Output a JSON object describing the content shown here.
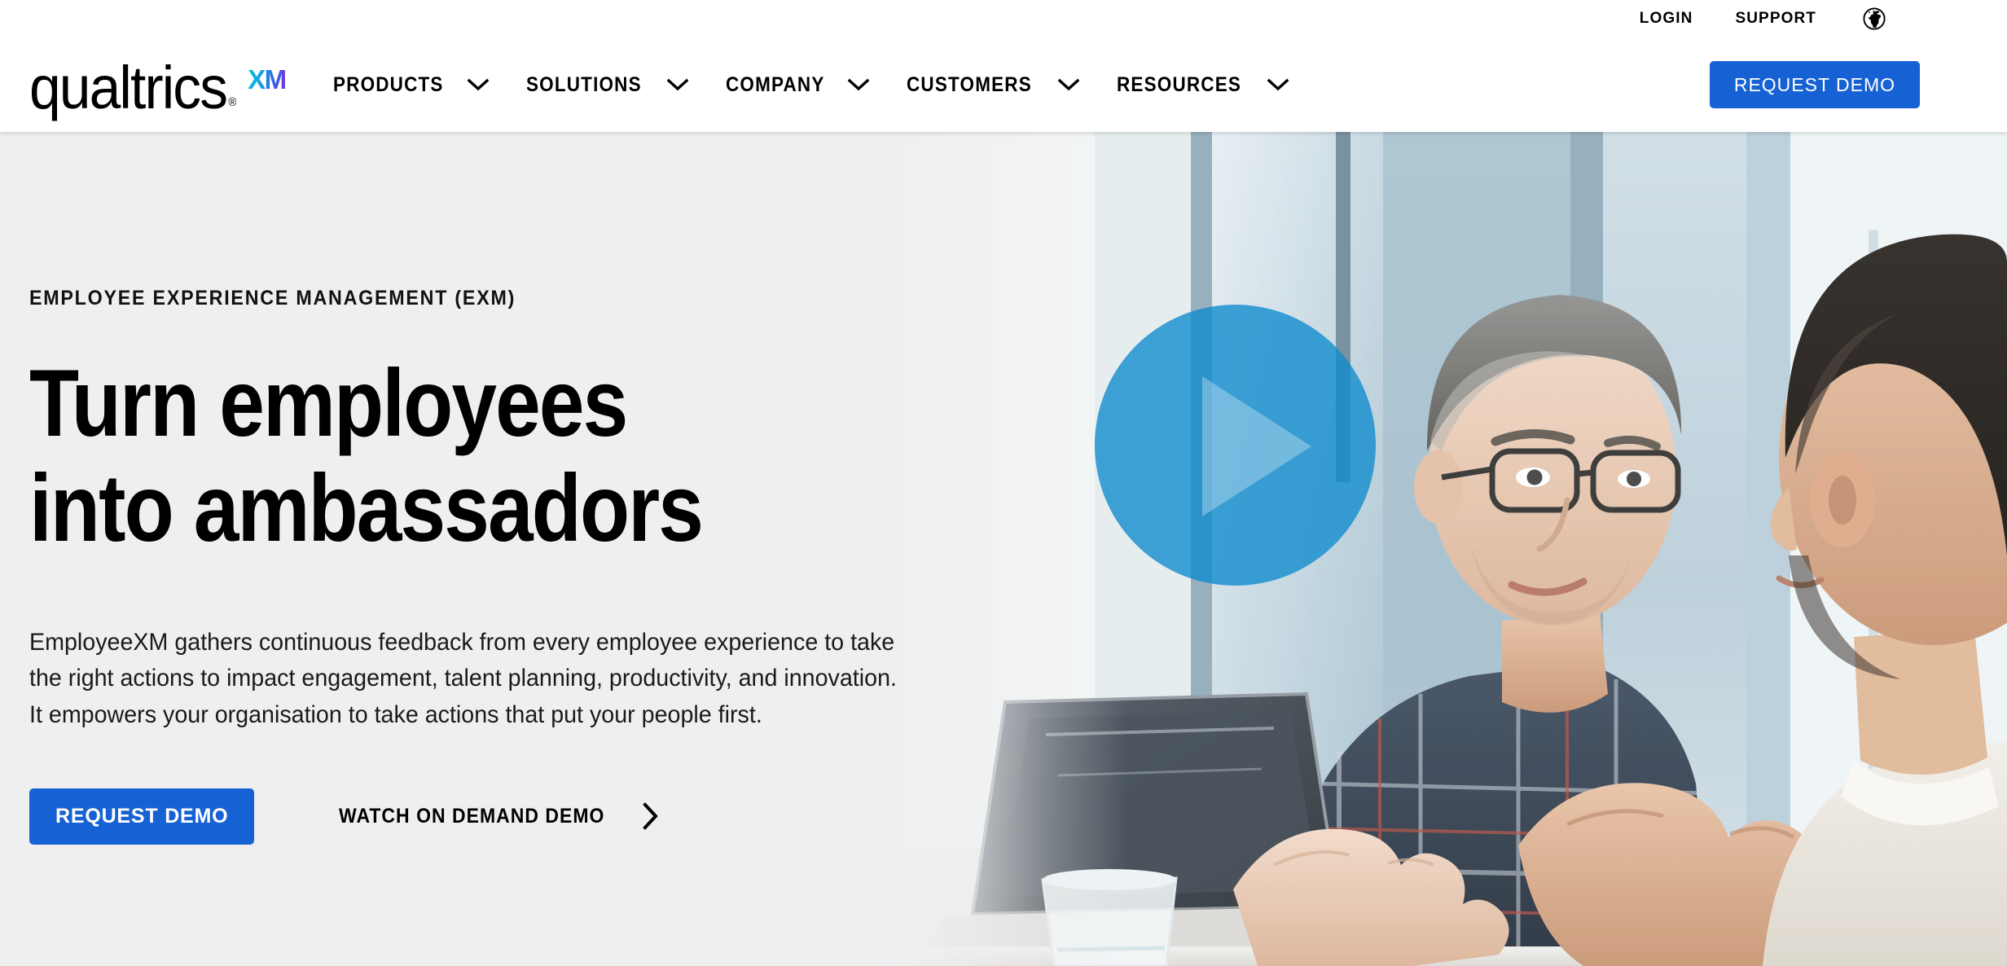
{
  "brand": {
    "logo_word": "qualtrics",
    "logo_registered": "®",
    "logo_suffix": "XM",
    "accent_blue": "#1662D4",
    "play_blue": "#118CCD",
    "hero_bg": "#EFEFF0",
    "xm_gradient_start": "#00C4E8",
    "xm_gradient_end": "#7B2FE0"
  },
  "utility": {
    "login_label": "LOGIN",
    "support_label": "SUPPORT",
    "language_icon": "globe-icon"
  },
  "nav": {
    "items": [
      {
        "label": "PRODUCTS",
        "icon": "chevron-down-icon"
      },
      {
        "label": "SOLUTIONS",
        "icon": "chevron-down-icon"
      },
      {
        "label": "COMPANY",
        "icon": "chevron-down-icon"
      },
      {
        "label": "CUSTOMERS",
        "icon": "chevron-down-icon"
      },
      {
        "label": "RESOURCES",
        "icon": "chevron-down-icon"
      }
    ],
    "cta_label": "REQUEST DEMO"
  },
  "hero": {
    "eyebrow": "EMPLOYEE EXPERIENCE MANAGEMENT (EXM)",
    "headline_line1": "Turn employees",
    "headline_line2": "into ambassadors",
    "body": "EmployeeXM gathers continuous feedback from every employee experience to take the right actions to impact engagement, talent planning, productivity, and innovation. It empowers your organisation to take actions that put your people first.",
    "primary_cta": "REQUEST DEMO",
    "secondary_cta": "WATCH ON DEMAND DEMO",
    "secondary_cta_icon": "chevron-right-icon",
    "play_button_icon": "play-icon"
  }
}
